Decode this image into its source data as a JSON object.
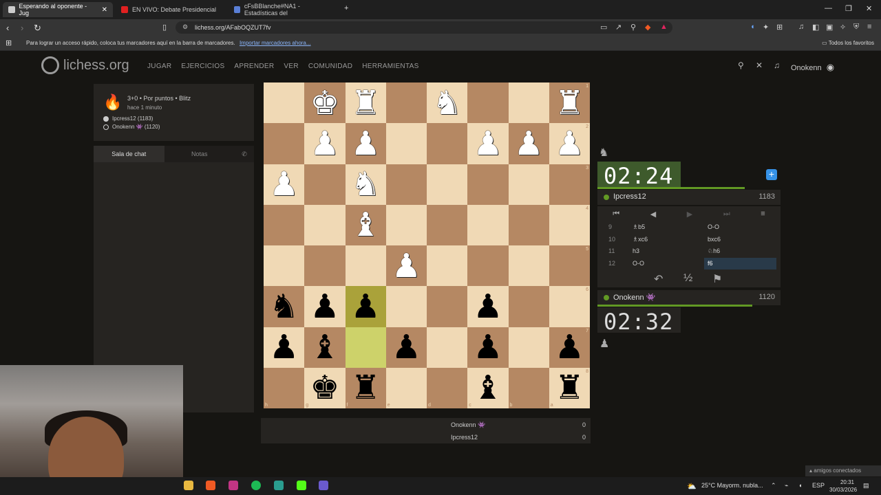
{
  "browser": {
    "tabs": [
      {
        "label": "Esperando al oponente - Jug",
        "fav_color": "#cccccc",
        "active": true
      },
      {
        "label": "EN VIVO: Debate Presidencial",
        "fav_color": "#e02020",
        "active": false
      },
      {
        "label": "cFsBBlanche#NA1 - Estadísticas del",
        "fav_color": "#5a7fd6",
        "active": false
      }
    ],
    "url": "lichess.org/AFabOQZUT7fv",
    "bookmarks_msg": "Para lograr un acceso rápido, coloca tus marcadores aquí en la barra de marcadores.",
    "bookmarks_link": "Importar marcadores ahora...",
    "all_favorites": "Todos los favoritos"
  },
  "site": {
    "logo": "lichess.org",
    "nav": [
      "JUGAR",
      "EJERCICIOS",
      "APRENDER",
      "VER",
      "COMUNIDAD",
      "HERRAMIENTAS"
    ],
    "username": "Onokenn"
  },
  "game": {
    "mode": "3+0 • Por puntos • Blitz",
    "ago": "hace 1 minuto",
    "white": "Ipcress12 (1183)",
    "black": "Onokenn 👾 (1120)"
  },
  "chat": {
    "tab_chat": "Sala de chat",
    "tab_notes": "Notas"
  },
  "board": {
    "ranks": [
      "1",
      "2",
      "3",
      "4",
      "5",
      "6",
      "7",
      "8"
    ],
    "files": [
      "h",
      "g",
      "f",
      "e",
      "d",
      "c",
      "b",
      "a"
    ],
    "rows": [
      [
        "",
        "wK",
        "wR",
        "",
        "wN",
        "",
        "",
        "wR"
      ],
      [
        "",
        "wP",
        "wP",
        "",
        "",
        "wP",
        "wP",
        "wP"
      ],
      [
        "wP",
        "",
        "wN",
        "",
        "",
        "",
        "",
        ""
      ],
      [
        "",
        "",
        "wB",
        "",
        "",
        "",
        "",
        ""
      ],
      [
        "",
        "",
        "",
        "wP",
        "",
        "",
        "",
        ""
      ],
      [
        "bN",
        "bP",
        "bP",
        "",
        "",
        "bP",
        "",
        ""
      ],
      [
        "bP",
        "bB",
        "",
        "bP",
        "",
        "bP",
        "",
        "bP"
      ],
      [
        "",
        "bK",
        "bR",
        "",
        "",
        "bB",
        "",
        "bR"
      ]
    ],
    "highlight": [
      [
        5,
        2
      ],
      [
        6,
        2
      ]
    ]
  },
  "scores": [
    {
      "name": "Onokenn 👾",
      "score": "0"
    },
    {
      "name": "Ipcress12",
      "score": "0"
    }
  ],
  "clocks": {
    "opponent": "02:24",
    "opponent_name": "Ipcress12",
    "opponent_rating": "1183",
    "self": "02:32",
    "self_name": "Onokenn 👾",
    "self_rating": "1120"
  },
  "moves": [
    {
      "n": "9",
      "w": "♗b5",
      "b": "O-O"
    },
    {
      "n": "10",
      "w": "♗xc6",
      "b": "bxc6"
    },
    {
      "n": "11",
      "w": "h3",
      "b": "♘h6"
    },
    {
      "n": "12",
      "w": "O-O",
      "b": "f6"
    }
  ],
  "taskbar": {
    "weather": "25°C  Mayorm. nubla...",
    "lang": "ESP",
    "time": "20:31",
    "date": "30/03/2026",
    "friends": "▴ amigos conectados"
  }
}
